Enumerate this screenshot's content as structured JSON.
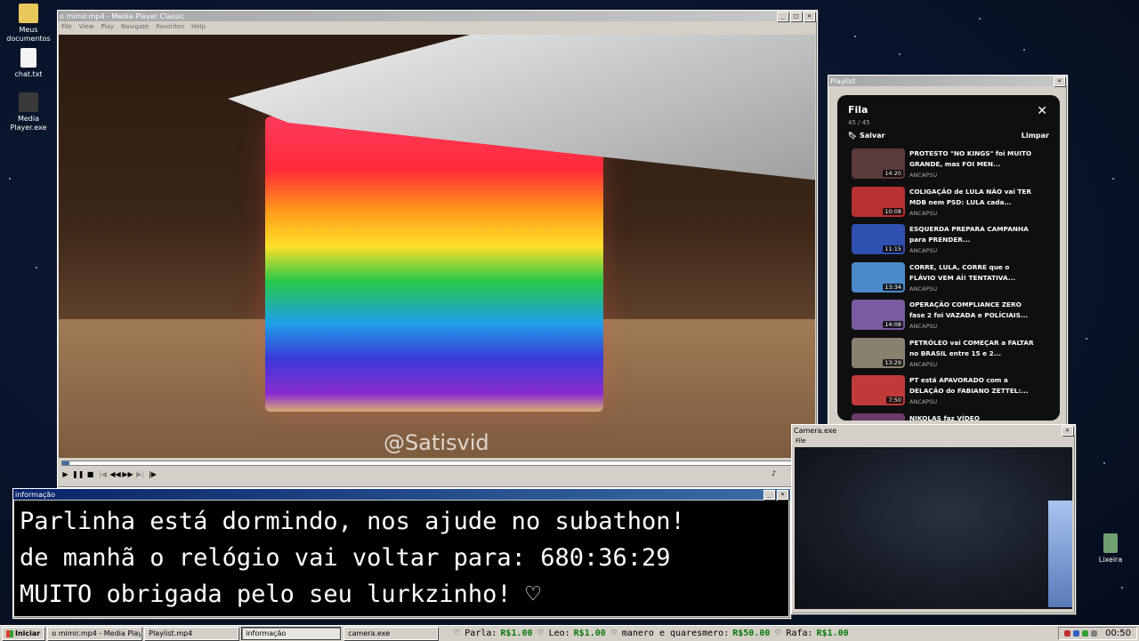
{
  "desktop": {
    "icons": [
      {
        "label": "Meus documentos",
        "icon": "folder-icon"
      },
      {
        "label": "chat.txt",
        "icon": "text-file-icon"
      },
      {
        "label": "Media Player.exe",
        "icon": "media-player-icon"
      },
      {
        "label": "Lixeira",
        "icon": "recycle-bin-icon"
      }
    ]
  },
  "player": {
    "title": "o mimir.mp4 - Media Player Classic",
    "menu": [
      "File",
      "View",
      "Play",
      "Navigate",
      "Favorites",
      "Help"
    ],
    "watermark": "@Satisvid",
    "progress": 0.01
  },
  "playlist": {
    "window_title": "Playlist",
    "header": "Fila",
    "count": "45 / 45",
    "save_label": "Salvar",
    "clear_label": "Limpar",
    "items": [
      {
        "title": "PROTESTO \"NO KINGS\" foi MUITO GRANDE, mas FOI MEN...",
        "channel": "ANCAPSU",
        "duration": "14:20",
        "color": "#5a3a3a"
      },
      {
        "title": "COLIGAÇÃO de LULA NÃO vai TER MDB nem PSD: LULA cada...",
        "channel": "ANCAPSU",
        "duration": "10:08",
        "color": "#b83030"
      },
      {
        "title": "ESQUERDA PREPARA CAMPANHA para PRENDER...",
        "channel": "ANCAPSU",
        "duration": "11:15",
        "color": "#3050b0"
      },
      {
        "title": "CORRE, LULA, CORRE que o FLÁVIO VEM AÍ! TENTATIVA...",
        "channel": "ANCAPSU",
        "duration": "13:34",
        "color": "#4a8ac8"
      },
      {
        "title": "OPERAÇÃO COMPLIANCE ZERO fase 2 foi VAZADA e POLÍCIAIS...",
        "channel": "ANCAPSU",
        "duration": "14:08",
        "color": "#7a5aa0"
      },
      {
        "title": "PETRÓLEO vai COMEÇAR a FALTAR no BRASIL entre 15 e 2...",
        "channel": "ANCAPSU",
        "duration": "13:29",
        "color": "#8a8070"
      },
      {
        "title": "PT está APAVORADO com a DELAÇÃO do FABIANO ZETTEL:...",
        "channel": "ANCAPSU",
        "duration": "7:50",
        "color": "#c03a3a"
      },
      {
        "title": "NIKOLAS faz VÍDEO",
        "channel": "",
        "duration": "",
        "color": "#6a3a6a"
      }
    ]
  },
  "info": {
    "title": "informação",
    "lines": [
      "Parlinha está dormindo, nos ajude no subathon!",
      "de manhã o relógio vai voltar para:  680:36:29",
      "MUITO obrigada pelo seu lurkzinho! ♡"
    ]
  },
  "camera": {
    "title": "Camera.exe",
    "menu": "File"
  },
  "taskbar": {
    "start": "Iniciar",
    "tasks": [
      "o mimir.mp4 - Media Playe...",
      "Playlist.mp4",
      "informação",
      "camera.exe"
    ],
    "active_task": 2,
    "ticker": [
      {
        "name": "Parla:",
        "amount": "R$1.00"
      },
      {
        "name": "Leo:",
        "amount": "R$1.00"
      },
      {
        "name": "manero e quaresmero:",
        "amount": "R$50.00"
      },
      {
        "name": "Rafa:",
        "amount": "R$1.00"
      }
    ],
    "clock": "00:50"
  }
}
